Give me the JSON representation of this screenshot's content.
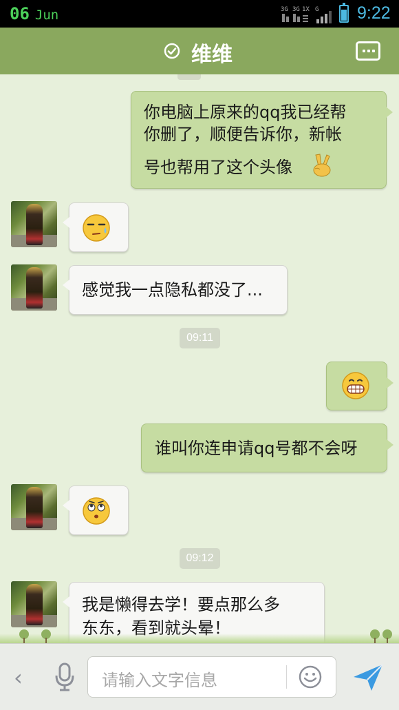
{
  "status_bar": {
    "day": "06",
    "month": "Jun",
    "network_labels": [
      "3G",
      "3G",
      "1X",
      "G"
    ],
    "time": "9:22",
    "colors": {
      "date": "#4cd05a",
      "time": "#4cb8e0"
    }
  },
  "header": {
    "title": "维维",
    "status_icon": "check-circle-icon",
    "menu_icon": "more-menu-icon",
    "color": "#8aa85e"
  },
  "messages": [
    {
      "side": "right",
      "type": "text",
      "text_line1": "你电脑上原来的qq我已经帮",
      "text_line2": "你删了，顺便告诉你，新帐",
      "text_line3": "号也帮用了这个头像",
      "emoji": "victory-hand-emoji"
    },
    {
      "side": "left",
      "type": "emoji",
      "emoji": "sweat-face-emoji"
    },
    {
      "side": "left",
      "type": "text",
      "text": "感觉我一点隐私都没了..."
    },
    {
      "type": "timestamp",
      "text": "09:11"
    },
    {
      "side": "right",
      "type": "emoji",
      "emoji": "grin-face-emoji"
    },
    {
      "side": "right",
      "type": "text",
      "text": "谁叫你连申请qq号都不会呀"
    },
    {
      "side": "left",
      "type": "emoji",
      "emoji": "eye-roll-face-emoji"
    },
    {
      "type": "timestamp",
      "text": "09:12"
    },
    {
      "side": "left",
      "type": "text",
      "text_line1": "我是懒得去学！要点那么多",
      "text_line2": "东东，看到就头晕！"
    }
  ],
  "input_bar": {
    "placeholder": "请输入文字信息",
    "back_icon": "chevron-left-icon",
    "mic_icon": "microphone-icon",
    "emoji_icon": "smiley-icon",
    "send_icon": "send-icon"
  }
}
